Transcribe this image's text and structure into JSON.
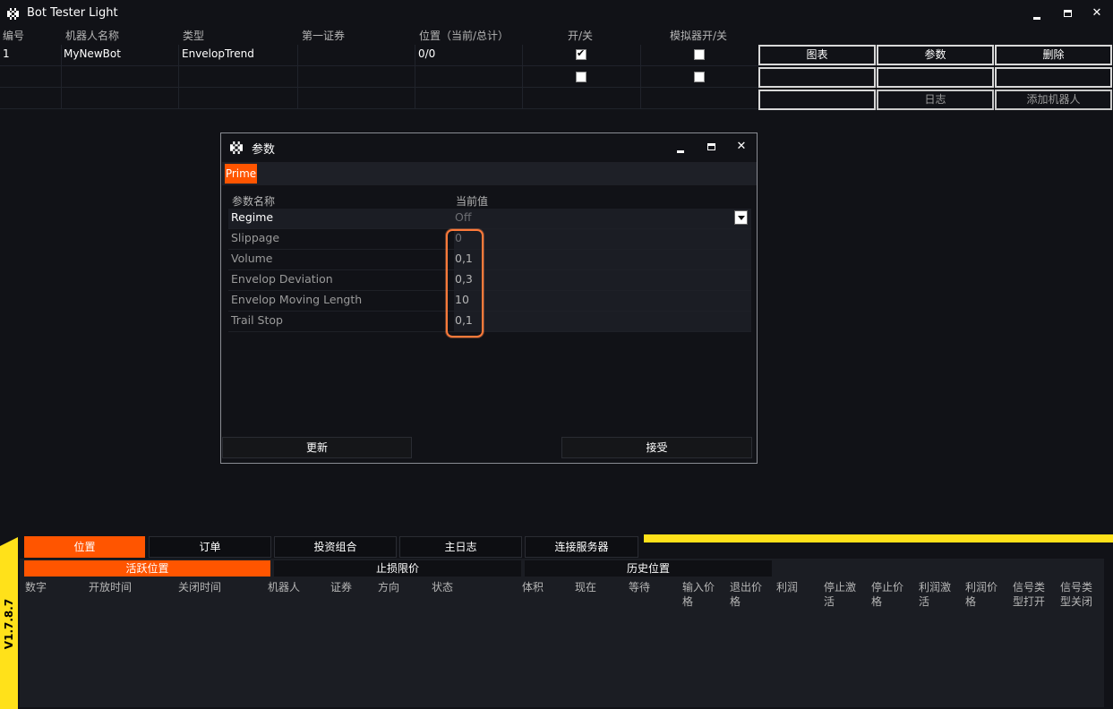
{
  "app": {
    "title": "Bot Tester Light",
    "icon": "checkerboard-logo-icon",
    "controls": [
      "minimize-icon",
      "maximize-icon",
      "close-icon"
    ]
  },
  "grid": {
    "headers": [
      "编号",
      "机器人名称",
      "类型",
      "第一证券",
      "位置（当前/总计）",
      "开/关",
      "模拟器开/关"
    ],
    "rows": [
      {
        "id": "1",
        "name": "MyNewBot",
        "type": "EnvelopTrend",
        "security": "",
        "position": "0/0",
        "on": true,
        "emulator": false
      },
      {
        "id": "",
        "name": "",
        "type": "",
        "security": "",
        "position": "",
        "on": false,
        "emulator": false
      },
      {
        "id": "",
        "name": "",
        "type": "",
        "security": "",
        "position": ""
      }
    ],
    "buttons": {
      "chart": "图表",
      "params": "参数",
      "delete": "删除",
      "journal": "日志",
      "add_bot": "添加机器人"
    }
  },
  "dialog": {
    "title": "参数",
    "tab": "Prime",
    "col_name": "参数名称",
    "col_value": "当前值",
    "params": [
      {
        "name": "Regime",
        "value": "Off"
      },
      {
        "name": "Slippage",
        "value": "0"
      },
      {
        "name": "Volume",
        "value": "0,1"
      },
      {
        "name": "Envelop Deviation",
        "value": "0,3"
      },
      {
        "name": "Envelop Moving Length",
        "value": "10"
      },
      {
        "name": "Trail Stop",
        "value": "0,1"
      }
    ],
    "update_button": "更新",
    "accept_button": "接受"
  },
  "bottom": {
    "version": "V1.7.8.7",
    "tabs": [
      "位置",
      "订单",
      "投资组合",
      "主日志",
      "连接服务器"
    ],
    "subtabs": [
      "活跃位置",
      "止损限价",
      "历史位置"
    ],
    "columns": [
      "数字",
      "开放时间",
      "关闭时间",
      "机器人",
      "证券",
      "方向",
      "状态",
      "体积",
      "现在",
      "等待",
      "输入价格",
      "退出价格",
      "利润",
      "停止激活",
      "停止价格",
      "利润激活",
      "利润价格",
      "信号类型打开",
      "信号类型关闭"
    ]
  },
  "colors": {
    "accent": "#ff5500",
    "highlight_outline": "#ff7a3a",
    "version_strip": "#ffe11a",
    "background": "#111217"
  }
}
